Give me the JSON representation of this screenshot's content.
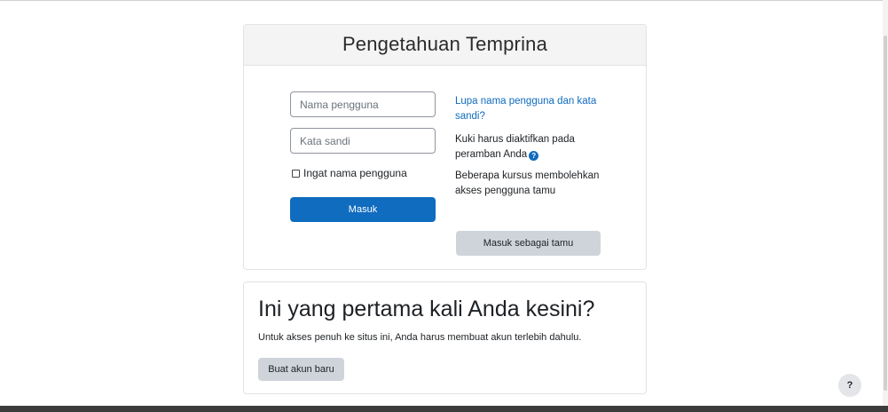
{
  "login": {
    "site_title": "Pengetahuan Temprina",
    "username_placeholder": "Nama pengguna",
    "password_placeholder": "Kata sandi",
    "remember_label": "Ingat nama pengguna",
    "login_button": "Masuk",
    "forgot_link": "Lupa nama pengguna dan kata sandi?",
    "cookies_text": "Kuki harus diaktifkan pada peramban Anda",
    "cookies_help_icon": "question-circle-icon",
    "guest_text": "Beberapa kursus membolehkan akses pengguna tamu",
    "guest_button": "Masuk sebagai tamu"
  },
  "signup": {
    "heading": "Ini yang pertama kali Anda kesini?",
    "text": "Untuk akses penuh ke situs ini, Anda harus membuat akun terlebih dahulu.",
    "button": "Buat akun baru"
  },
  "footer": {
    "help_label": "?"
  },
  "colors": {
    "primary": "#0f6cbf",
    "secondary_button": "#ced4da",
    "header_bg": "#f4f4f4"
  }
}
